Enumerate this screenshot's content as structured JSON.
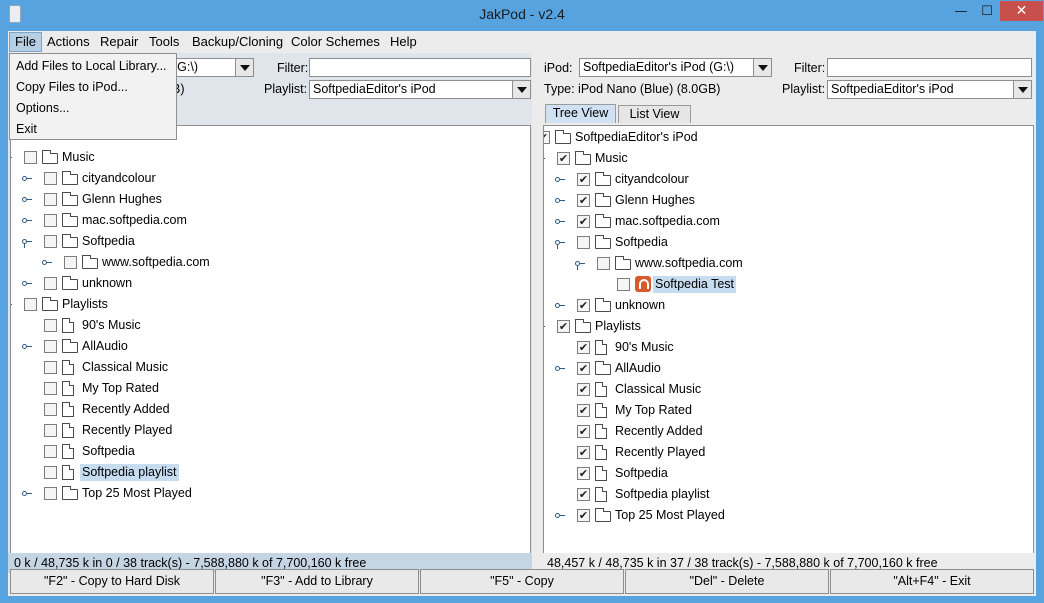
{
  "window": {
    "title": "JakPod - v2.4",
    "min_glyph": "—",
    "max_glyph": "☐",
    "close_glyph": "✕"
  },
  "menubar": {
    "items": [
      "File",
      "Actions",
      "Repair",
      "Tools",
      "Backup/Cloning",
      "Color Schemes",
      "Help"
    ],
    "active": "File"
  },
  "file_menu": {
    "items": [
      "Add Files to Local Library...",
      "Copy Files to iPod...",
      "Options...",
      "Exit"
    ]
  },
  "left": {
    "drive_value": "(G:\\)",
    "filter_label": "Filter:",
    "filter_value": "",
    "size_fragment": "B)",
    "playlist_label": "Playlist:",
    "playlist_value": "SoftpediaEditor's iPod",
    "tree": [
      {
        "label": "Music",
        "depth": 0,
        "kind": "folder",
        "handle": "open",
        "checked": false
      },
      {
        "label": "cityandcolour",
        "depth": 1,
        "kind": "folder",
        "handle": "closed",
        "checked": false
      },
      {
        "label": "Glenn Hughes",
        "depth": 1,
        "kind": "folder",
        "handle": "closed",
        "checked": false
      },
      {
        "label": "mac.softpedia.com",
        "depth": 1,
        "kind": "folder",
        "handle": "closed",
        "checked": false
      },
      {
        "label": "Softpedia",
        "depth": 1,
        "kind": "folder",
        "handle": "open",
        "checked": false
      },
      {
        "label": "www.softpedia.com",
        "depth": 2,
        "kind": "folder",
        "handle": "closed",
        "checked": false
      },
      {
        "label": "unknown",
        "depth": 1,
        "kind": "folder",
        "handle": "closed",
        "checked": false
      },
      {
        "label": "Playlists",
        "depth": 0,
        "kind": "folder",
        "handle": "open",
        "checked": false
      },
      {
        "label": "90's Music",
        "depth": 1,
        "kind": "file",
        "handle": "none",
        "checked": false
      },
      {
        "label": "AllAudio",
        "depth": 1,
        "kind": "folder",
        "handle": "closed",
        "checked": false
      },
      {
        "label": "Classical Music",
        "depth": 1,
        "kind": "file",
        "handle": "none",
        "checked": false
      },
      {
        "label": "My Top Rated",
        "depth": 1,
        "kind": "file",
        "handle": "none",
        "checked": false
      },
      {
        "label": "Recently Added",
        "depth": 1,
        "kind": "file",
        "handle": "none",
        "checked": false
      },
      {
        "label": "Recently Played",
        "depth": 1,
        "kind": "file",
        "handle": "none",
        "checked": false
      },
      {
        "label": "Softpedia",
        "depth": 1,
        "kind": "file",
        "handle": "none",
        "checked": false
      },
      {
        "label": "Softpedia playlist",
        "depth": 1,
        "kind": "file",
        "handle": "none",
        "checked": false,
        "selected": true
      },
      {
        "label": "Top 25 Most Played",
        "depth": 1,
        "kind": "folder",
        "handle": "closed",
        "checked": false
      }
    ],
    "status": "0 k /  48,735 k in   0 /  38 track(s)  -  7,588,880 k of 7,700,160 k free"
  },
  "right": {
    "ipod_label": "iPod:",
    "ipod_value": "SoftpediaEditor's iPod (G:\\)",
    "filter_label": "Filter:",
    "filter_value": "",
    "type_text": "Type:  iPod Nano (Blue) (8.0GB)",
    "playlist_label": "Playlist:",
    "playlist_value": "SoftpediaEditor's iPod",
    "tabs": [
      "Tree View",
      "List View"
    ],
    "tree": [
      {
        "label": "SoftpediaEditor's iPod",
        "depth": -1,
        "kind": "folder",
        "handle": "none",
        "checked": true
      },
      {
        "label": "Music",
        "depth": 0,
        "kind": "folder",
        "handle": "open",
        "checked": true
      },
      {
        "label": "cityandcolour",
        "depth": 1,
        "kind": "folder",
        "handle": "closed",
        "checked": true
      },
      {
        "label": "Glenn Hughes",
        "depth": 1,
        "kind": "folder",
        "handle": "closed",
        "checked": true
      },
      {
        "label": "mac.softpedia.com",
        "depth": 1,
        "kind": "folder",
        "handle": "closed",
        "checked": true
      },
      {
        "label": "Softpedia",
        "depth": 1,
        "kind": "folder",
        "handle": "open",
        "checked": false
      },
      {
        "label": "www.softpedia.com",
        "depth": 2,
        "kind": "folder",
        "handle": "open",
        "checked": false
      },
      {
        "label": "Softpedia Test",
        "depth": 3,
        "kind": "song",
        "handle": "none",
        "checked": false,
        "selected": true
      },
      {
        "label": "unknown",
        "depth": 1,
        "kind": "folder",
        "handle": "closed",
        "checked": true
      },
      {
        "label": "Playlists",
        "depth": 0,
        "kind": "folder",
        "handle": "open",
        "checked": true
      },
      {
        "label": "90's Music",
        "depth": 1,
        "kind": "file",
        "handle": "none",
        "checked": true
      },
      {
        "label": "AllAudio",
        "depth": 1,
        "kind": "folder",
        "handle": "closed",
        "checked": true
      },
      {
        "label": "Classical Music",
        "depth": 1,
        "kind": "file",
        "handle": "none",
        "checked": true
      },
      {
        "label": "My Top Rated",
        "depth": 1,
        "kind": "file",
        "handle": "none",
        "checked": true
      },
      {
        "label": "Recently Added",
        "depth": 1,
        "kind": "file",
        "handle": "none",
        "checked": true
      },
      {
        "label": "Recently Played",
        "depth": 1,
        "kind": "file",
        "handle": "none",
        "checked": true
      },
      {
        "label": "Softpedia",
        "depth": 1,
        "kind": "file",
        "handle": "none",
        "checked": true
      },
      {
        "label": "Softpedia playlist",
        "depth": 1,
        "kind": "file",
        "handle": "none",
        "checked": true
      },
      {
        "label": "Top 25 Most Played",
        "depth": 1,
        "kind": "folder",
        "handle": "closed",
        "checked": true
      }
    ],
    "status": "48,457 k /  48,735 k in  37 /  38 track(s)  -  7,588,880 k of 7,700,160 k free"
  },
  "footer_buttons": [
    "\"F2\" - Copy to Hard Disk",
    "\"F3\" - Add to Library",
    "\"F5\" - Copy",
    "\"Del\" - Delete",
    "\"Alt+F4\" - Exit"
  ],
  "icons": {
    "folder": "folder-icon",
    "file": "playlist-file-icon",
    "song": "song-icon",
    "check": "✔"
  },
  "colors": {
    "titlebar": "#56a3e0",
    "close": "#c7504d",
    "selection": "#c6dcf0",
    "left_status": "#c5d5e4"
  }
}
